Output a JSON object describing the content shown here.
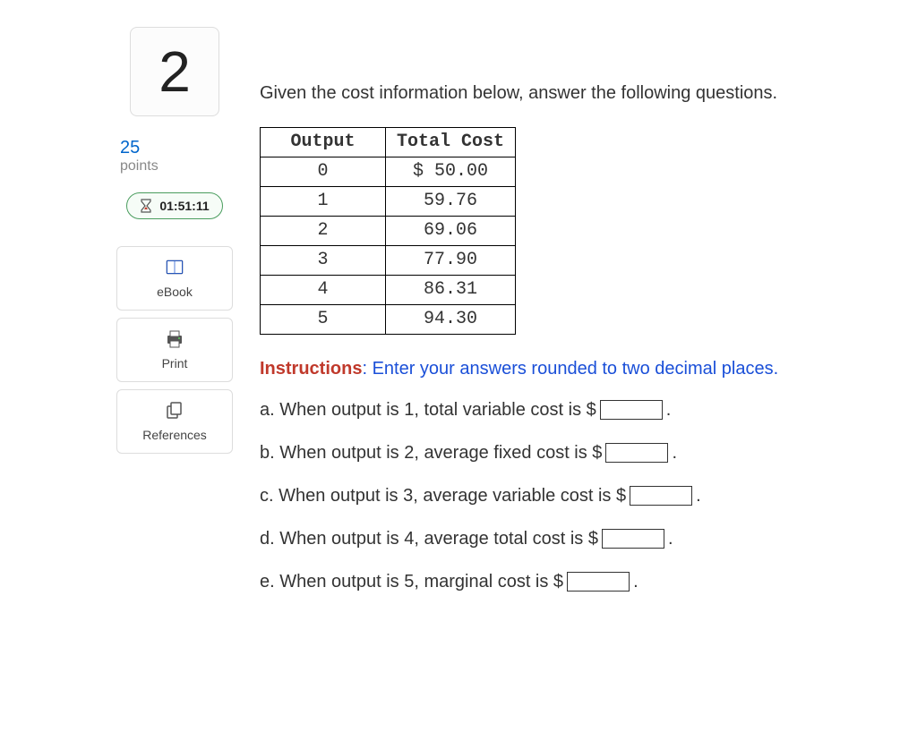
{
  "sidebar": {
    "question_number": "2",
    "points_value": "25",
    "points_label": "points",
    "timer": "01:51:11",
    "tools": {
      "ebook": "eBook",
      "print": "Print",
      "references": "References"
    }
  },
  "content": {
    "intro": "Given the cost information below, answer the following questions.",
    "table": {
      "headers": [
        "Output",
        "Total Cost"
      ],
      "rows": [
        [
          "0",
          "$ 50.00"
        ],
        [
          "1",
          "59.76"
        ],
        [
          "2",
          "69.06"
        ],
        [
          "3",
          "77.90"
        ],
        [
          "4",
          "86.31"
        ],
        [
          "5",
          "94.30"
        ]
      ]
    },
    "instructions_label": "Instructions",
    "instructions_text": ": Enter your answers rounded to two decimal places.",
    "questions": {
      "a": {
        "pre": "a. When output is 1, total variable cost is $ ",
        "post": " ."
      },
      "b": {
        "pre": "b. When output is 2, average fixed cost is $ ",
        "post": " ."
      },
      "c": {
        "pre": "c. When output is 3, average variable cost is $ ",
        "post": " ."
      },
      "d": {
        "pre": "d. When output is 4, average total cost is $ ",
        "post": " ."
      },
      "e": {
        "pre": "e. When output is 5, marginal cost is $ ",
        "post": " ."
      }
    }
  }
}
